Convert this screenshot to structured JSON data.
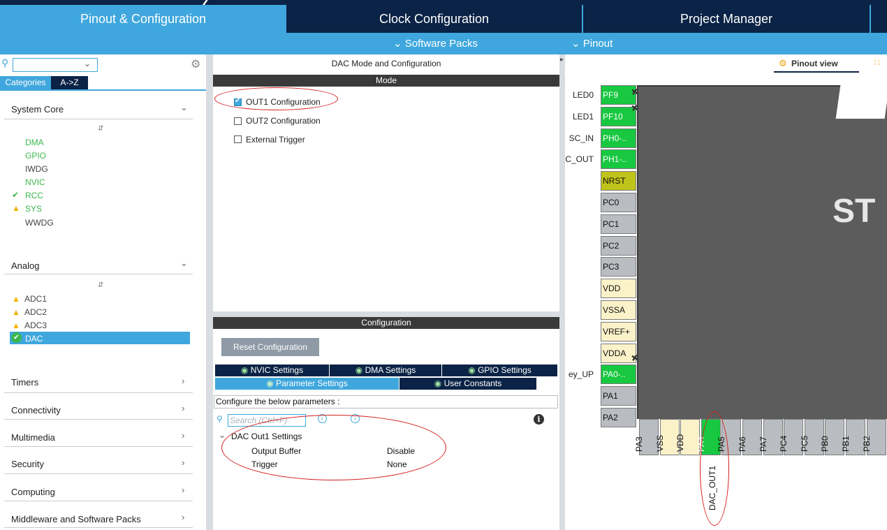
{
  "main_tabs": {
    "pinout": "Pinout & Configuration",
    "clock": "Clock Configuration",
    "project": "Project Manager"
  },
  "subbar": {
    "software_packs": "Software Packs",
    "pinout": "Pinout"
  },
  "left": {
    "tabs": {
      "categories": "Categories",
      "az": "A->Z"
    },
    "system_core": {
      "label": "System Core",
      "items": [
        "DMA",
        "GPIO",
        "IWDG",
        "NVIC",
        "RCC",
        "SYS",
        "WWDG"
      ]
    },
    "analog": {
      "label": "Analog",
      "items": [
        "ADC1",
        "ADC2",
        "ADC3",
        "DAC"
      ]
    },
    "collapsed": [
      "Timers",
      "Connectivity",
      "Multimedia",
      "Security",
      "Computing",
      "Middleware and Software Packs"
    ]
  },
  "center": {
    "title": "DAC Mode and Configuration",
    "mode_header": "Mode",
    "mode_options": [
      {
        "label": "OUT1 Configuration",
        "checked": true
      },
      {
        "label": "OUT2 Configuration",
        "checked": false
      },
      {
        "label": "External Trigger",
        "checked": false
      }
    ],
    "config_header": "Configuration",
    "reset_button": "Reset Configuration",
    "tabs_row1": [
      "NVIC Settings",
      "DMA Settings",
      "GPIO Settings"
    ],
    "tabs_row2": [
      "Parameter Settings",
      "User Constants"
    ],
    "configure_text": "Configure the below parameters :",
    "search_placeholder": "Search (Ctrl+F)",
    "group": "DAC Out1 Settings",
    "params": [
      {
        "name": "Output Buffer",
        "value": "Disable"
      },
      {
        "name": "Trigger",
        "value": "None"
      }
    ]
  },
  "right": {
    "view_label": "Pinout view",
    "chip_text": "ST",
    "left_pins": [
      {
        "label": "LED0",
        "pin": "PF9",
        "color": "green"
      },
      {
        "label": "LED1",
        "pin": "PF10",
        "color": "green"
      },
      {
        "label": "SC_IN",
        "pin": "PH0-..",
        "color": "green"
      },
      {
        "label": "C_OUT",
        "pin": "PH1-..",
        "color": "green"
      },
      {
        "label": "",
        "pin": "NRST",
        "color": "olive"
      },
      {
        "label": "",
        "pin": "PC0",
        "color": "grey"
      },
      {
        "label": "",
        "pin": "PC1",
        "color": "grey"
      },
      {
        "label": "",
        "pin": "PC2",
        "color": "grey"
      },
      {
        "label": "",
        "pin": "PC3",
        "color": "grey"
      },
      {
        "label": "",
        "pin": "VDD",
        "color": "cream"
      },
      {
        "label": "",
        "pin": "VSSA",
        "color": "cream"
      },
      {
        "label": "",
        "pin": "VREF+",
        "color": "cream"
      },
      {
        "label": "",
        "pin": "VDDA",
        "color": "cream"
      },
      {
        "label": "ey_UP",
        "pin": "PA0-..",
        "color": "green"
      },
      {
        "label": "",
        "pin": "PA1",
        "color": "grey"
      },
      {
        "label": "",
        "pin": "PA2",
        "color": "grey"
      }
    ],
    "bottom_pins": [
      {
        "pin": "PA3",
        "color": "grey"
      },
      {
        "pin": "VSS",
        "color": "cream"
      },
      {
        "pin": "VDD",
        "color": "cream"
      },
      {
        "pin": "PA4",
        "color": "green"
      },
      {
        "pin": "PA5",
        "color": "grey"
      },
      {
        "pin": "PA6",
        "color": "grey"
      },
      {
        "pin": "PA7",
        "color": "grey"
      },
      {
        "pin": "PC4",
        "color": "grey"
      },
      {
        "pin": "PC5",
        "color": "grey"
      },
      {
        "pin": "PB0",
        "color": "grey"
      },
      {
        "pin": "PB1",
        "color": "grey"
      },
      {
        "pin": "PB2",
        "color": "grey"
      }
    ],
    "pa4_signal": "DAC_OUT1"
  },
  "colors": {
    "accent": "#3fa7dd",
    "navy": "#0b2346",
    "pin_green": "#18c840",
    "annotation_red": "#d31d1d"
  }
}
